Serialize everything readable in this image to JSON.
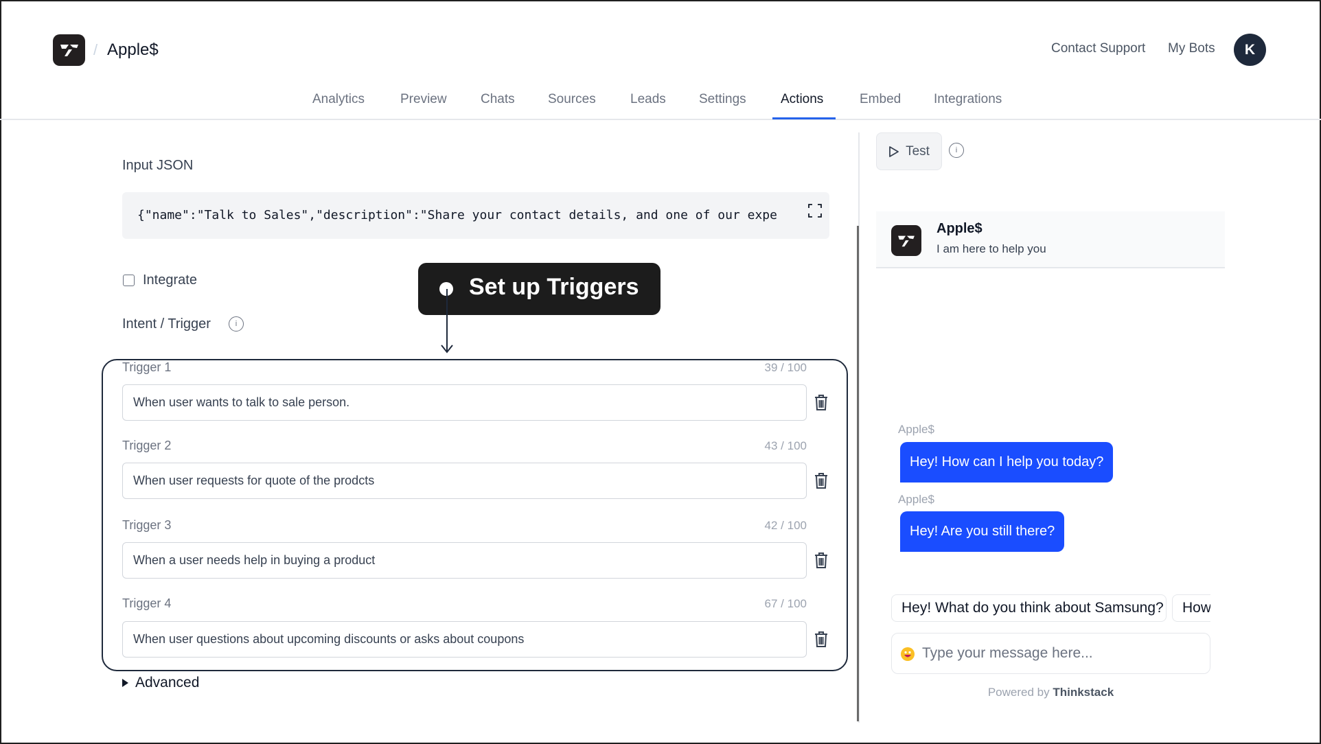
{
  "header": {
    "breadcrumb_separator": "/",
    "bot_name": "Apple$",
    "contact_support": "Contact Support",
    "my_bots": "My Bots",
    "avatar_initial": "K"
  },
  "tabs": [
    {
      "label": "Analytics",
      "active": false
    },
    {
      "label": "Preview",
      "active": false
    },
    {
      "label": "Chats",
      "active": false
    },
    {
      "label": "Sources",
      "active": false
    },
    {
      "label": "Leads",
      "active": false
    },
    {
      "label": "Settings",
      "active": false
    },
    {
      "label": "Actions",
      "active": true
    },
    {
      "label": "Embed",
      "active": false
    },
    {
      "label": "Integrations",
      "active": false
    }
  ],
  "form": {
    "input_json_label": "Input JSON",
    "input_json_value": "{\"name\":\"Talk to Sales\",\"description\":\"Share your contact details, and one of our expe",
    "integrate_label": "Integrate",
    "integrate_checked": false,
    "intent_label": "Intent / Trigger",
    "info_glyph": "i",
    "triggers": [
      {
        "label": "Trigger 1",
        "count": "39 / 100",
        "value": "When user wants to talk to sale person."
      },
      {
        "label": "Trigger 2",
        "count": "43 / 100",
        "value": "When user requests for quote of the prodcts"
      },
      {
        "label": "Trigger 3",
        "count": "42 / 100",
        "value": "When a user needs help in buying a product"
      },
      {
        "label": "Trigger 4",
        "count": "67 / 100",
        "value": "When user questions about upcoming discounts or asks about coupons"
      }
    ],
    "advanced_label": "Advanced"
  },
  "callout": {
    "text": "Set up Triggers"
  },
  "test_panel": {
    "test_label": "Test",
    "info_glyph": "i",
    "chat_title": "Apple$",
    "chat_subtitle": "I am here to help you",
    "messages": [
      {
        "sender": "Apple$",
        "text": "Hey! How can I help you today?"
      },
      {
        "sender": "Apple$",
        "text": "Hey! Are you still there?"
      }
    ],
    "suggestions": [
      "Hey! What do you think about Samsung?",
      "How"
    ],
    "message_placeholder": "Type your message here...",
    "powered_by_prefix": "Powered by",
    "powered_by_brand": "Thinkstack"
  },
  "colors": {
    "accent": "#2563eb",
    "bubble": "#1a4dff",
    "logo_bg": "#231f20",
    "avatar_bg": "#1e293b",
    "callout_bg": "#1c1c1c"
  }
}
